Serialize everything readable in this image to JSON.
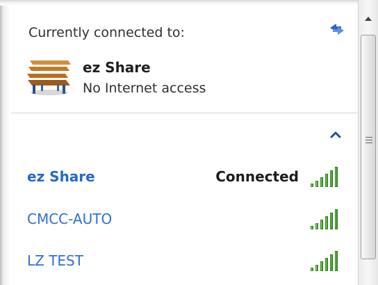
{
  "panel": {
    "header_label": "Currently connected to:",
    "refresh_icon": "refresh-icon",
    "current_network": {
      "icon": "bench-network-icon",
      "name": "ez Share",
      "status": "No Internet access"
    },
    "collapse_icon": "chevron-up-icon"
  },
  "networks": [
    {
      "name": "ez Share",
      "status": "Connected",
      "signal_icon": "signal-strength-icon",
      "signal_level": 5
    },
    {
      "name": "CMCC-AUTO",
      "status": "",
      "signal_icon": "signal-strength-icon",
      "signal_level": 5
    },
    {
      "name": "LZ TEST",
      "status": "",
      "signal_icon": "signal-strength-icon",
      "signal_level": 5
    }
  ],
  "colors": {
    "link": "#2f6fd0",
    "signal_green": "#2e8b1f",
    "separator": "#d5d5d5"
  }
}
